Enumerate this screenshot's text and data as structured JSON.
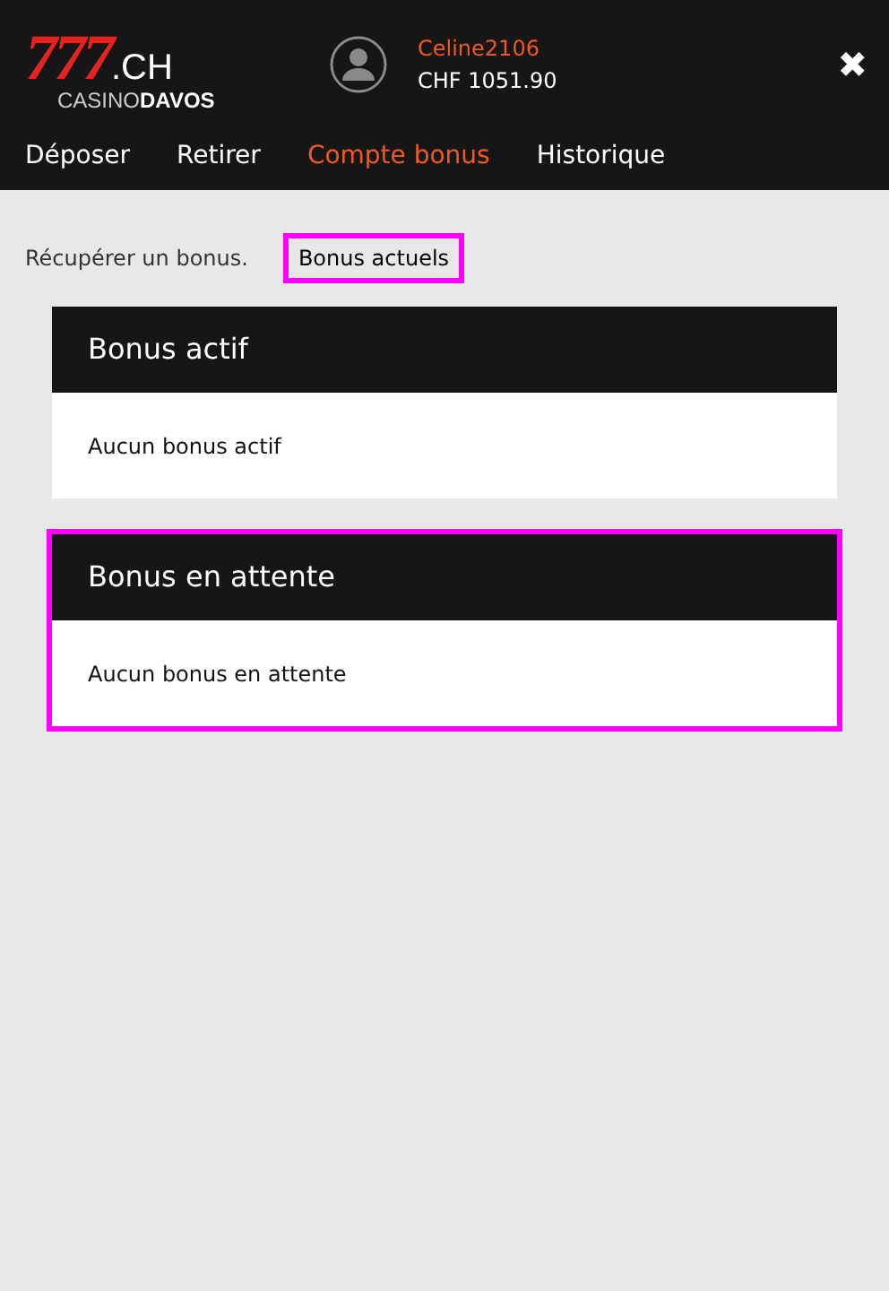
{
  "header": {
    "logo": {
      "number": "777",
      "suffix": ".CH",
      "subtitle_left": "CASINO",
      "subtitle_right": "DAVOS"
    },
    "user": {
      "name": "Celine2106",
      "balance": "CHF 1051.90"
    },
    "close": "✖"
  },
  "tabs": [
    {
      "label": "Déposer",
      "selected": false
    },
    {
      "label": "Retirer",
      "selected": false
    },
    {
      "label": "Compte bonus",
      "selected": true
    },
    {
      "label": "Historique",
      "selected": false
    }
  ],
  "subtabs": [
    {
      "label": "Récupérer un bonus.",
      "highlighted": false
    },
    {
      "label": "Bonus actuels",
      "highlighted": true
    }
  ],
  "panels": [
    {
      "title": "Bonus actif",
      "message": "Aucun bonus actif",
      "highlighted": false
    },
    {
      "title": "Bonus en attente",
      "message": "Aucun bonus en attente",
      "highlighted": true
    }
  ]
}
